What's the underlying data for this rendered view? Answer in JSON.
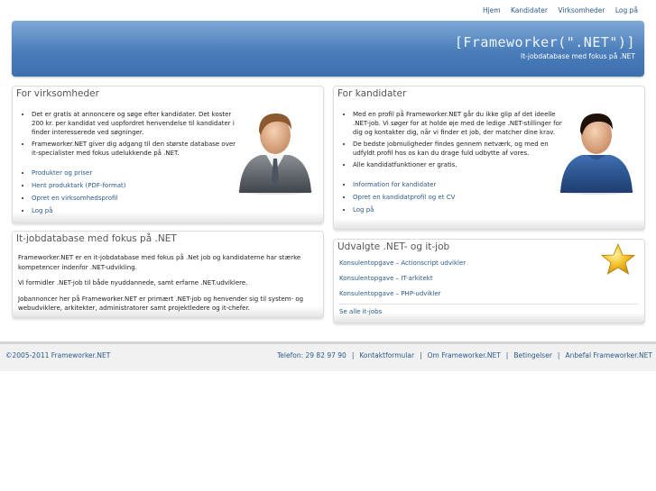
{
  "topnav": {
    "items": [
      "Hjem",
      "Kandidater",
      "Virksomheder",
      "Log på"
    ]
  },
  "banner": {
    "brand": "[Frameworker(\".NET\")]",
    "tagline": "It-jobdatabase med fokus på .NET"
  },
  "virksomheder": {
    "title": "For virksomheder",
    "bullets": [
      "Det er gratis at annoncere og søge efter kandidater. Det koster 200 kr. per kandidat ved uopfordret henvendelse til kandidater i finder interesserede ved søgninger.",
      "Frameworker.NET giver dig adgang til den største database over it-specialister med fokus udelukkende på .NET."
    ],
    "links": [
      "Produkter og priser",
      "Hent produktark (PDF-format)",
      "Opret en virksomhedsprofil",
      "Log på"
    ]
  },
  "kandidater": {
    "title": "For kandidater",
    "bullets": [
      "Med en profil på Frameworker.NET går du ikke glip af det ideelle .NET-job. Vi søger for at holde øje med de ledige .NET-stillinger for dig og kontakter dig, når vi finder et job, der matcher dine krav.",
      "De bedste jobmuligheder findes gennem netværk, og med en udfyldt profil hos os kan du drage fuld udbytte af vores.",
      "Alle kandidatfunktioner er gratis."
    ],
    "links": [
      "Information for kandidater",
      "Opret en kandidatprofil og et CV",
      "Log på"
    ]
  },
  "database": {
    "title": "It-jobdatabase med fokus på .NET",
    "p1": "Frameworker.NET er en it-jobdatabase med fokus på .Net job og kandidaterne har stærke kompetencer indenfor .NET-udvikling.",
    "p2": "Vi formidler .NET-job til både nyuddannede, samt erfarne .NET.udviklere.",
    "p3": "Jobannoncer her på Frameworker.NET er primært .NET-job og henvender sig til system- og webudviklere, arkitekter, administratorer samt projektledere og it-chefer."
  },
  "udvalgte": {
    "title": "Udvalgte .NET- og it-job",
    "jobs": [
      "Konsulentopgave – Actionscript udvikler",
      "Konsulentopgave – IT-arkitekt",
      "Konsulentopgave – PHP-udvikler"
    ],
    "see_all": "Se alle it-jobs"
  },
  "footer": {
    "copyright": "©2005-2011 Frameworker.NET",
    "links": [
      "Telefon: 29 82 97 90",
      "Kontaktformular",
      "Om Frameworker.NET",
      "Betingelser",
      "Anbefal Frameworker.NET"
    ]
  },
  "colors": {
    "banner_top": "#7fa9d6",
    "banner_bottom": "#3c6fae",
    "link": "#2a5a8c"
  },
  "icons": {
    "business_avatar": "businessman-icon",
    "candidate_avatar": "candidate-icon",
    "star": "star-icon"
  }
}
